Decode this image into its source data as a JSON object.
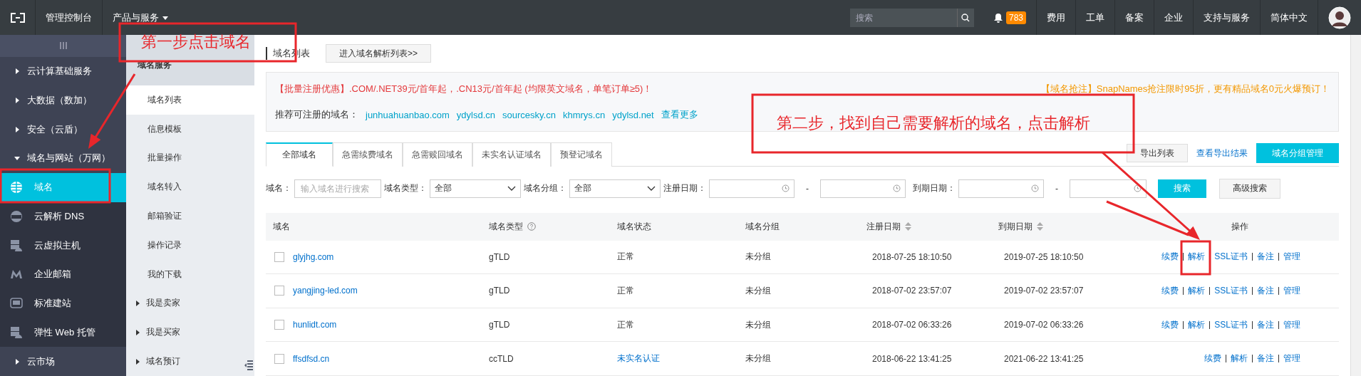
{
  "topbar": {
    "console": "管理控制台",
    "products": "产品与服务",
    "search": {
      "placeholder": "搜索"
    },
    "notice_count": "783",
    "links": [
      "费用",
      "工单",
      "备案",
      "企业",
      "支持与服务",
      "简体中文"
    ]
  },
  "sidebar": {
    "items": [
      {
        "label": "云计算基础服务",
        "expanded": false
      },
      {
        "label": "大数据（数加）",
        "expanded": false
      },
      {
        "label": "安全（云盾）",
        "expanded": false
      },
      {
        "label": "域名与网站（万网）",
        "expanded": true,
        "children": [
          {
            "label": "域名",
            "selected": true
          },
          {
            "label": "云解析 DNS",
            "selected": false
          },
          {
            "label": "云虚拟主机",
            "selected": false
          },
          {
            "label": "企业邮箱",
            "selected": false
          },
          {
            "label": "标准建站",
            "selected": false
          },
          {
            "label": "弹性 Web 托管",
            "selected": false
          }
        ]
      },
      {
        "label": "云市场",
        "expanded": false
      }
    ]
  },
  "subnav": {
    "title": "域名服务",
    "items": [
      {
        "label": "域名列表",
        "selected": true,
        "kind": "page"
      },
      {
        "label": "信息模板",
        "selected": false,
        "kind": "page"
      },
      {
        "label": "批量操作",
        "selected": false,
        "kind": "page"
      },
      {
        "label": "域名转入",
        "selected": false,
        "kind": "page"
      },
      {
        "label": "邮箱验证",
        "selected": false,
        "kind": "page"
      },
      {
        "label": "操作记录",
        "selected": false,
        "kind": "page"
      },
      {
        "label": "我的下载",
        "selected": false,
        "kind": "page"
      },
      {
        "label": "我是卖家",
        "selected": false,
        "kind": "folder"
      },
      {
        "label": "我是买家",
        "selected": false,
        "kind": "folder"
      },
      {
        "label": "域名预订",
        "selected": false,
        "kind": "folder"
      }
    ]
  },
  "page_title": "域名列表",
  "dns_list_button": "进入域名解析列表>>",
  "promo": {
    "offer": "【批量注册优惠】.COM/.NET39元/首年起，.CN13元/首年起 (均限英文域名，单笔订单≥5)！",
    "snap": "【域名抢注】SnapNames抢注限时95折，更有精品域名0元火爆预订！",
    "recommend_label": "推荐可注册的域名：",
    "domains": [
      "junhuahuanbao.com",
      "ydylsd.cn",
      "sourcesky.cn",
      "khmrys.cn",
      "ydylsd.net"
    ],
    "more": "查看更多"
  },
  "tabs": [
    {
      "label": "全部域名",
      "selected": true
    },
    {
      "label": "急需续费域名",
      "selected": false
    },
    {
      "label": "急需赎回域名",
      "selected": false
    },
    {
      "label": "未实名认证域名",
      "selected": false
    },
    {
      "label": "预登记域名",
      "selected": false
    }
  ],
  "toolbar": {
    "export": "导出列表",
    "view_export": "查看导出结果",
    "group_manage": "域名分组管理"
  },
  "filters": {
    "domain_label": "域名：",
    "domain_placeholder": "输入域名进行搜索",
    "type_label": "域名类型：",
    "type_value": "全部",
    "group_label": "域名分组：",
    "group_value": "全部",
    "reg_label": "注册日期：",
    "exp_label": "到期日期：",
    "dash": "-",
    "search": "搜索",
    "advanced": "高级搜索"
  },
  "table": {
    "columns": [
      "域名",
      "域名类型",
      "域名状态",
      "域名分组",
      "注册日期",
      "到期日期",
      "操作"
    ],
    "rows": [
      {
        "checked": false,
        "domain": "glyjhg.com",
        "type": "gTLD",
        "status": {
          "text": "正常",
          "kind": "plain"
        },
        "group": "未分组",
        "registered": "2018-07-25 18:10:50",
        "expires": "2019-07-25 18:10:50",
        "actions": [
          "续费",
          "解析",
          "SSL证书",
          "备注",
          "管理"
        ]
      },
      {
        "checked": false,
        "domain": "yangjing-led.com",
        "type": "gTLD",
        "status": {
          "text": "正常",
          "kind": "plain"
        },
        "group": "未分组",
        "registered": "2018-07-02 23:57:07",
        "expires": "2019-07-02 23:57:07",
        "actions": [
          "续费",
          "解析",
          "SSL证书",
          "备注",
          "管理"
        ]
      },
      {
        "checked": false,
        "domain": "hunlidt.com",
        "type": "gTLD",
        "status": {
          "text": "正常",
          "kind": "plain"
        },
        "group": "未分组",
        "registered": "2018-07-02 06:33:26",
        "expires": "2019-07-02 06:33:26",
        "actions": [
          "续费",
          "解析",
          "SSL证书",
          "备注",
          "管理"
        ]
      },
      {
        "checked": false,
        "domain": "ffsdfsd.cn",
        "type": "ccTLD",
        "status": {
          "text": "未实名认证",
          "kind": "link"
        },
        "group": "未分组",
        "registered": "2018-06-22 13:41:25",
        "expires": "2021-06-22 13:41:25",
        "actions": [
          "续费",
          "解析",
          "备注",
          "管理"
        ]
      }
    ]
  },
  "annotations": [
    "第一步点击域名",
    "第二步，找到自己需要解析的域名，点击解析"
  ]
}
